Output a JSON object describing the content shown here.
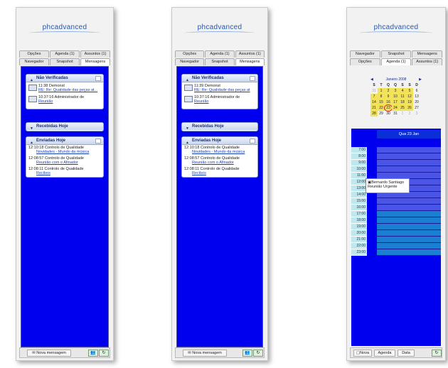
{
  "brand": {
    "logo_text": "phcadvanced"
  },
  "panel1": {
    "tabs_row1": [
      "Opções",
      "Agenda (1)",
      "Assuntos (1)"
    ],
    "tabs_row2": [
      "Navegador",
      "Snapshot",
      "Mensagens"
    ],
    "active_tab": "Mensagens",
    "unverified": {
      "title": "Não Verificadas",
      "items": [
        {
          "time": "11:38",
          "from": "Demonst",
          "subject": "RE: Re: Qualidade das peças at..."
        },
        {
          "time": "10:37:16",
          "from": "Administrador de",
          "subject": "Reunião"
        }
      ]
    },
    "received_today": {
      "title": "Recebidas Hoje"
    },
    "sent_today": {
      "title": "Enviadas Hoje",
      "items": [
        {
          "time": "12:10:18",
          "from": "Controlo de Qualidade",
          "subject": "Novidades - Mundo da música"
        },
        {
          "time": "12:08:57",
          "from": "Controlo de Qualidade",
          "subject": "Reunião com o Afinador"
        },
        {
          "time": "12:08:11",
          "from": "Controlo de Qualidade",
          "subject": "Recibos"
        }
      ]
    },
    "footer": {
      "new_message": "Nova mensagem"
    }
  },
  "panel2": {
    "tabs_row1": [
      "Opções",
      "Agenda (1)",
      "Assuntos (1)"
    ],
    "tabs_row2": [
      "Navegador",
      "Snapshot",
      "Mensagens"
    ],
    "unverified": {
      "title": "Não Verificadas",
      "items": [
        {
          "time": "11:39",
          "from": "Demonst",
          "subject": "RE: Re: Qualidade das peças at"
        },
        {
          "time": "10:37:16",
          "from": "Administrador de",
          "subject": "Reunião"
        }
      ]
    },
    "received_today": {
      "title": "Recebidas Hoje"
    },
    "sent_today": {
      "title": "Enviadas Hoje",
      "items": [
        {
          "time": "12:10:18",
          "from": "Controlo de Qualidade",
          "subject": "Novidades - Mundo da música"
        },
        {
          "time": "12:08:57",
          "from": "Controlo de Qualidade",
          "subject": "Reunião com o Afinador"
        },
        {
          "time": "12:08:11",
          "from": "Controlo de Qualidade",
          "subject": "Recibos"
        }
      ]
    },
    "footer": {
      "new_message": "Nova mensagem"
    }
  },
  "panel3": {
    "tabs_row1": [
      "Navegador",
      "Snapshot",
      "Mensagens"
    ],
    "tabs_row2": [
      "Opções",
      "Agenda (1)",
      "Assuntos (1)"
    ],
    "month_label": "Janeiro 2008",
    "weekday_headers": [
      "S",
      "T",
      "Q",
      "Q",
      "S",
      "S",
      "D"
    ],
    "weeks": [
      [
        "31",
        "1",
        "2",
        "3",
        "4",
        "5",
        "6"
      ],
      [
        "7",
        "8",
        "9",
        "10",
        "11",
        "12",
        "13"
      ],
      [
        "14",
        "15",
        "16",
        "17",
        "18",
        "19",
        "20"
      ],
      [
        "21",
        "22",
        "23",
        "24",
        "25",
        "26",
        "27"
      ],
      [
        "28",
        "29",
        "30",
        "31",
        "1",
        "2",
        "3"
      ]
    ],
    "day_header": "Qua 23 Jan",
    "hours": [
      "7:00",
      "8:00",
      "9:00",
      "10:00",
      "11:00",
      "12:00",
      "13:00",
      "14:00",
      "15:00",
      "16:00",
      "17:00",
      "18:00",
      "19:00",
      "20:00",
      "21:00",
      "22:00",
      "23:00"
    ],
    "appointment": {
      "person": "Bernardo Santiago",
      "title": "Reunião Urgente"
    },
    "footer": {
      "new": "Nova",
      "agenda": "Agenda",
      "date": "Data"
    }
  },
  "colors": {
    "blue_bg": "#0000ee",
    "highlight_day": "#f1e25a",
    "hour_col": "#bfe8ee"
  }
}
